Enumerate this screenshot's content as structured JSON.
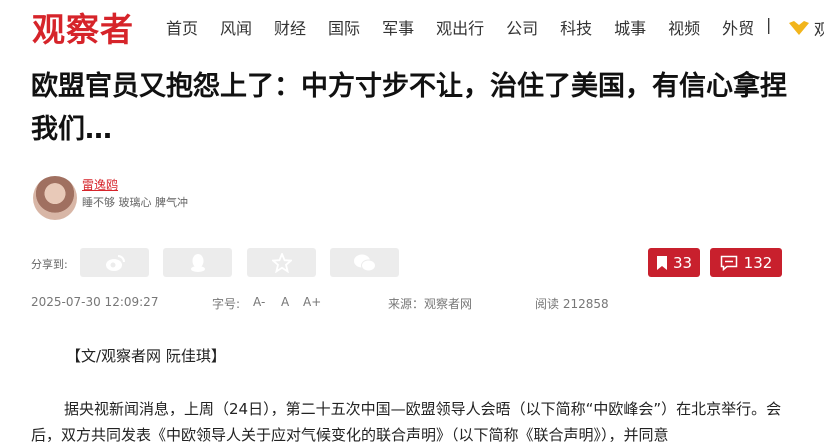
{
  "header": {
    "logo": "观察者",
    "nav": [
      "首页",
      "风闻",
      "财经",
      "国际",
      "军事",
      "观出行",
      "公司",
      "科技",
      "城事",
      "视频",
      "外贸"
    ],
    "separator": "|",
    "vip_label": "观"
  },
  "article": {
    "title": "欧盟官员又抱怨上了：中方寸步不让，治住了美国，有信心拿捏我们…",
    "author": "雷逸鸥",
    "author_bio": "睡不够 玻璃心 脾气冲",
    "share_label": "分享到:",
    "bookmark_count": "33",
    "comment_count": "132",
    "date": "2025-07-30 12:09:27",
    "font_label": "字号:",
    "font_sizes": [
      "A-",
      "A",
      "A+"
    ],
    "source": "来源：观察者网",
    "reads": "阅读 212858",
    "byline": "【文/观察者网 阮佳琪】",
    "paragraph": "据央视新闻消息，上周（24日），第二十五次中国—欧盟领导人会晤（以下简称“中欧峰会”）在北京举行。会后，双方共同发表《中欧领导人关于应对气候变化的联合声明》（以下简称《联合声明》），并同意"
  },
  "colors": {
    "brand": "#d6242a",
    "badge": "#c8202d"
  }
}
